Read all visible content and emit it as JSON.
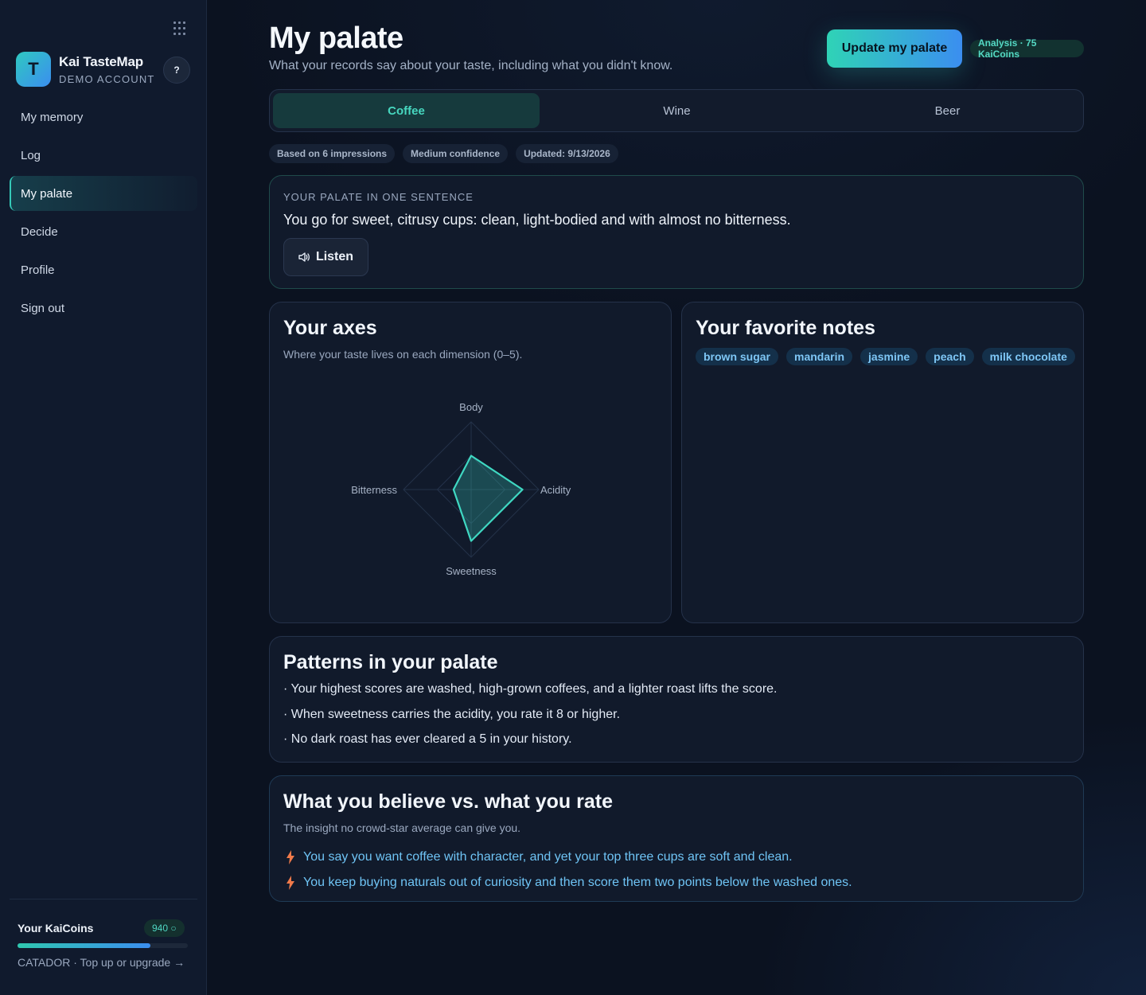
{
  "sidebar": {
    "brand_name": "Kai TasteMap",
    "brand_sub": "DEMO ACCOUNT",
    "logo_letter": "T",
    "help": "?",
    "items": [
      {
        "label": "My memory"
      },
      {
        "label": "Log"
      },
      {
        "label": "My palate",
        "active": true
      },
      {
        "label": "Decide"
      },
      {
        "label": "Profile"
      },
      {
        "label": "Sign out"
      }
    ],
    "coins_label": "Your KaiCoins",
    "coins_value": "940 ○",
    "coins_progress": 0.78,
    "coins_link": "CATADOR · Top up or upgrade →"
  },
  "header": {
    "title": "My palate",
    "subtitle": "What your records say about your taste, including what you didn't know.",
    "update_button": "Update my palate",
    "analysis_badge": "Analysis · 75 KaiCoins"
  },
  "tabs": [
    {
      "label": "Coffee",
      "active": true
    },
    {
      "label": "Wine"
    },
    {
      "label": "Beer"
    }
  ],
  "meta": [
    "Based on 6 impressions",
    "Medium confidence",
    "Updated: 9/13/2026"
  ],
  "sentence_card": {
    "eyebrow": "YOUR PALATE IN ONE SENTENCE",
    "sentence": "You go for sweet, citrusy cups: clean, light-bodied and with almost no bitterness.",
    "listen": "Listen"
  },
  "axes_card": {
    "title": "Your axes",
    "desc": "Where your taste lives on each dimension (0–5).",
    "chart_data": {
      "type": "radar",
      "axes": [
        "Body",
        "Acidity",
        "Sweetness",
        "Bitterness"
      ],
      "values": [
        2.5,
        3.8,
        3.8,
        1.3
      ],
      "max": 5
    }
  },
  "notes_card": {
    "title": "Your favorite notes",
    "notes": [
      "brown sugar",
      "mandarin",
      "jasmine",
      "peach",
      "milk chocolate"
    ]
  },
  "patterns_card": {
    "title": "Patterns in your palate",
    "items": [
      "· Your highest scores are washed, high-grown coffees, and a lighter roast lifts the score.",
      "· When sweetness carries the acidity, you rate it 8 or higher.",
      "· No dark roast has ever cleared a 5 in your history."
    ]
  },
  "believe_card": {
    "title": "What you believe vs. what you rate",
    "desc": "The insight no crowd-star average can give you.",
    "items": [
      "You say you want coffee with character, and yet your top three cups are soft and clean.",
      "You keep buying naturals out of curiosity and then score them two points below the washed ones."
    ]
  },
  "colors": {
    "accent": "#35c9b8",
    "blue": "#3b8ef0",
    "bolt": "#f07a4a"
  }
}
